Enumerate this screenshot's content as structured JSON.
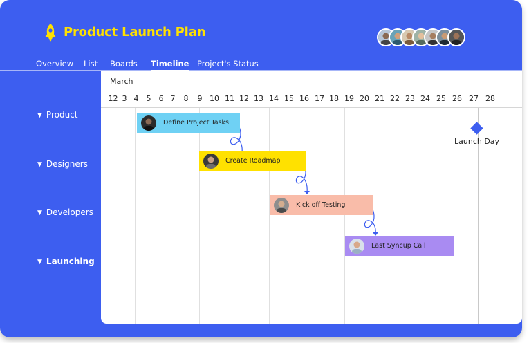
{
  "app": {
    "title": "Product Launch Plan",
    "accent_color": "#3d5ef0",
    "title_color": "#ffe100",
    "logo_icon": "rocket-icon"
  },
  "team_avatars": [
    "avatar-1",
    "avatar-2",
    "avatar-3",
    "avatar-4",
    "avatar-5",
    "avatar-6",
    "avatar-7"
  ],
  "tabs": [
    {
      "label": "Overview",
      "active": false
    },
    {
      "label": "List",
      "active": false
    },
    {
      "label": "Boards",
      "active": false
    },
    {
      "label": "Timeline",
      "active": true
    },
    {
      "label": "Project's Status",
      "active": false
    }
  ],
  "groups": [
    {
      "label": "Product",
      "expanded": true
    },
    {
      "label": "Designers",
      "expanded": true
    },
    {
      "label": "Developers",
      "expanded": true
    },
    {
      "label": "Launching",
      "expanded": true
    }
  ],
  "timeline": {
    "month": "March",
    "days": [
      "1",
      "2",
      "3",
      "4",
      "5",
      "6",
      "7",
      "8",
      "9",
      "10",
      "11",
      "12",
      "13",
      "14",
      "15",
      "16",
      "17",
      "18",
      "19",
      "20",
      "21",
      "22",
      "23",
      "24",
      "25",
      "26",
      "27",
      "28"
    ]
  },
  "tasks": [
    {
      "label": "Define Project Tasks",
      "color": "#6fd1f4"
    },
    {
      "label": "Create Roadmap",
      "color": "#ffe100"
    },
    {
      "label": "Kick off Testing",
      "color": "#f9bca9"
    },
    {
      "label": "Last Syncup Call",
      "color": "#a98bf2"
    }
  ],
  "milestone": {
    "label": "Launch Day",
    "day": 26
  }
}
